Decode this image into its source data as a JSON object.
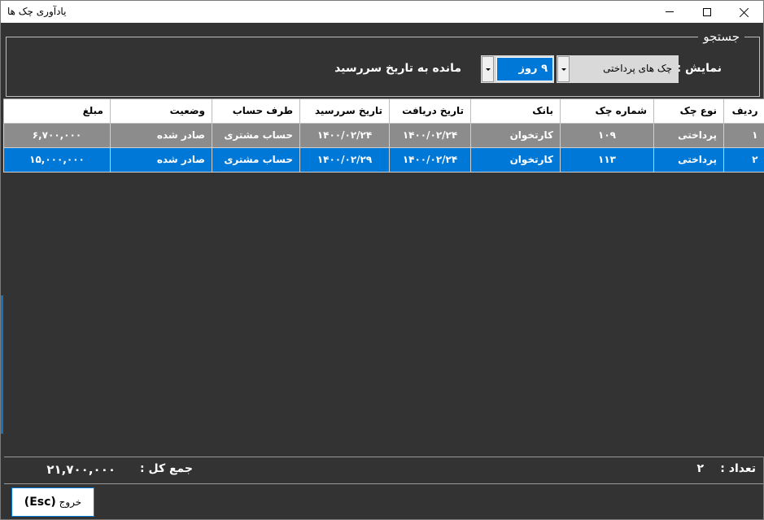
{
  "window": {
    "title": "یادآوری چک ها"
  },
  "search": {
    "legend": "جستجو",
    "display_label": "نمایش :",
    "check_type_value": "چک های پرداختی",
    "days_value": "۹ روز",
    "remaining_label": "مانده به تاریخ سررسید"
  },
  "grid": {
    "columns": [
      "ردیف",
      "نوع چک",
      "شماره چک",
      "بانک",
      "تاریخ دریافت",
      "تاریخ سررسید",
      "طرف حساب",
      "وضعیت",
      "مبلغ"
    ],
    "rows": [
      [
        "۱",
        "پرداختی",
        "۱۰۹",
        "کارتخوان",
        "۱۴۰۰/۰۲/۲۴",
        "۱۴۰۰/۰۲/۲۴",
        "حساب مشتری",
        "صادر شده",
        "۶,۷۰۰,۰۰۰"
      ],
      [
        "۲",
        "پرداختی",
        "۱۱۳",
        "کارتخوان",
        "۱۴۰۰/۰۲/۲۴",
        "۱۴۰۰/۰۲/۲۹",
        "حساب مشتری",
        "صادر شده",
        "۱۵,۰۰۰,۰۰۰"
      ]
    ]
  },
  "footer": {
    "count_label": "تعداد :",
    "count_value": "۲",
    "total_label": "جمع کل :",
    "total_value": "۲۱,۷۰۰,۰۰۰",
    "exit_label": "خروج",
    "exit_key": "(Esc)"
  },
  "colors": {
    "selection": "#0078d7",
    "row_gray": "#8c8c8c",
    "background": "#333333"
  }
}
